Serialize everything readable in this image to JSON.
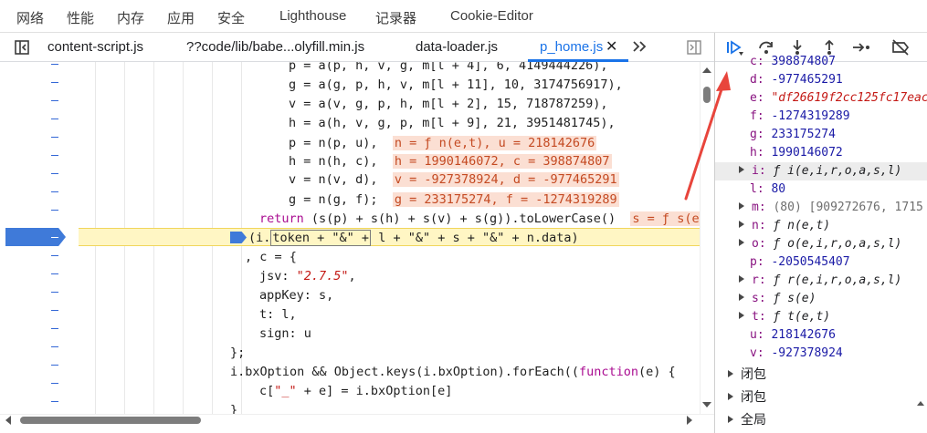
{
  "top_tabs": [
    "网络",
    "性能",
    "内存",
    "应用",
    "安全",
    "Lighthouse",
    "记录器",
    "Cookie-Editor"
  ],
  "file_tabs": [
    "content-script.js",
    "??code/lib/babe...olyfill.min.js",
    "data-loader.js",
    "p_home.js"
  ],
  "code_lines": {
    "l0_pre": "p = a(p, h, v, g, m[l + 4], 6, 4149444226),",
    "l1": "g = a(g, p, h, v, m[l + 11], 10, 3174756917),",
    "l2": "v = a(v, g, p, h, m[l + 2], 15, 718787259),",
    "l3": "h = a(h, v, g, p, m[l + 9], 21, 3951481745),",
    "l4": "p = n(p, u),",
    "l4_val": "n = ƒ n(e,t), u = 218142676",
    "l5": "h = n(h, c),",
    "l5_val": "h = 1990146072, c = 398874807",
    "l6": "v = n(v, d),",
    "l6_val": "v = -927378924, d = -977465291",
    "l7": "g = n(g, f);",
    "l7_val": "g = 233175274, f = -1274319289",
    "l8_kw": "return",
    "l8_rest": " (s(p) + s(h) + s(v) + s(g)).toLowerCase()",
    "l8_val": "s = ƒ s(e)",
    "l9_a": "(i.",
    "l9_token": "token + \"&\" +",
    "l9_b": " l + \"&\" + s + \"&\" + n.data)",
    "l10": ", c = {",
    "l11_key": "jsv: ",
    "l11_str": "\"2.7.5\"",
    "l11_end": ",",
    "l12": "appKey: s,",
    "l13": "t: l,",
    "l14": "sign: u",
    "l15": "};",
    "l16_a": "i.bxOption && Object.keys(i.bxOption).forEach((",
    "l16_kw": "function",
    "l16_b": "(e) {",
    "l17_a": "c[",
    "l17_str": "\"_\"",
    "l17_b": " + e] = i.bxOption[e]",
    "l18": "}"
  },
  "scope": [
    {
      "key": "c",
      "value": "398874807",
      "kind": "num"
    },
    {
      "key": "d",
      "value": "-977465291",
      "kind": "num"
    },
    {
      "key": "e",
      "value": "\"df26619f2cc125fc17eac",
      "kind": "str"
    },
    {
      "key": "f",
      "value": "-1274319289",
      "kind": "num"
    },
    {
      "key": "g",
      "value": "233175274",
      "kind": "num"
    },
    {
      "key": "h",
      "value": "1990146072",
      "kind": "num"
    },
    {
      "key": "i",
      "value": "ƒ i(e,i,r,o,a,s,l)",
      "kind": "fn",
      "expandable": true
    },
    {
      "key": "l",
      "value": "80",
      "kind": "num"
    },
    {
      "key": "m",
      "value": "(80) [909272676, 1715",
      "kind": "arr",
      "expandable": true
    },
    {
      "key": "n",
      "value": "ƒ n(e,t)",
      "kind": "fn",
      "expandable": true
    },
    {
      "key": "o",
      "value": "ƒ o(e,i,r,o,a,s,l)",
      "kind": "fn",
      "expandable": true
    },
    {
      "key": "p",
      "value": "-2050545407",
      "kind": "num"
    },
    {
      "key": "r",
      "value": "ƒ r(e,i,r,o,a,s,l)",
      "kind": "fn",
      "expandable": true
    },
    {
      "key": "s",
      "value": "ƒ s(e)",
      "kind": "fn",
      "expandable": true
    },
    {
      "key": "t",
      "value": "ƒ t(e,t)",
      "kind": "fn",
      "expandable": true
    },
    {
      "key": "u",
      "value": "218142676",
      "kind": "num"
    },
    {
      "key": "v",
      "value": "-927378924",
      "kind": "num"
    }
  ],
  "scope_sections": [
    "闭包",
    "闭包",
    "全局"
  ],
  "colors": {
    "accent": "#1a73e8",
    "annotation": "#e8453c",
    "exec_line": "#fff6c4"
  }
}
